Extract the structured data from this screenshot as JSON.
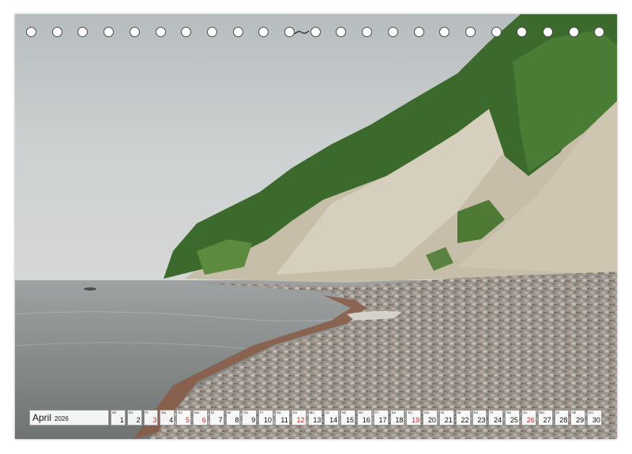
{
  "calendar": {
    "month": "April",
    "year": "2026",
    "days": [
      {
        "wd": "Mi",
        "d": "1",
        "type": "normal"
      },
      {
        "wd": "Do",
        "d": "2",
        "type": "normal"
      },
      {
        "wd": "Fr",
        "d": "3",
        "type": "hol"
      },
      {
        "wd": "Sa",
        "d": "4",
        "type": "normal"
      },
      {
        "wd": "So",
        "d": "5",
        "type": "sun"
      },
      {
        "wd": "Mo",
        "d": "6",
        "type": "hol"
      },
      {
        "wd": "Di",
        "d": "7",
        "type": "normal"
      },
      {
        "wd": "Mi",
        "d": "8",
        "type": "normal"
      },
      {
        "wd": "Do",
        "d": "9",
        "type": "normal"
      },
      {
        "wd": "Fr",
        "d": "10",
        "type": "normal"
      },
      {
        "wd": "Sa",
        "d": "11",
        "type": "normal"
      },
      {
        "wd": "So",
        "d": "12",
        "type": "sun"
      },
      {
        "wd": "Mo",
        "d": "13",
        "type": "normal"
      },
      {
        "wd": "Di",
        "d": "14",
        "type": "normal"
      },
      {
        "wd": "Mi",
        "d": "15",
        "type": "normal"
      },
      {
        "wd": "Do",
        "d": "16",
        "type": "normal"
      },
      {
        "wd": "Fr",
        "d": "17",
        "type": "normal"
      },
      {
        "wd": "Sa",
        "d": "18",
        "type": "normal"
      },
      {
        "wd": "So",
        "d": "19",
        "type": "sun"
      },
      {
        "wd": "Mo",
        "d": "20",
        "type": "normal"
      },
      {
        "wd": "Di",
        "d": "21",
        "type": "normal"
      },
      {
        "wd": "Mi",
        "d": "22",
        "type": "normal"
      },
      {
        "wd": "Do",
        "d": "23",
        "type": "normal"
      },
      {
        "wd": "Fr",
        "d": "24",
        "type": "normal"
      },
      {
        "wd": "Sa",
        "d": "25",
        "type": "normal"
      },
      {
        "wd": "So",
        "d": "26",
        "type": "sun"
      },
      {
        "wd": "Mo",
        "d": "27",
        "type": "normal"
      },
      {
        "wd": "Di",
        "d": "28",
        "type": "normal"
      },
      {
        "wd": "Mi",
        "d": "29",
        "type": "normal"
      },
      {
        "wd": "Do",
        "d": "30",
        "type": "normal"
      }
    ]
  },
  "binding": {
    "holes": 23
  },
  "colors": {
    "holiday": "#c0282d",
    "sky": "#c9cdcf",
    "sea": "#8e9394",
    "chalk": "#c8bfae",
    "forest": "#3f6a2e"
  }
}
